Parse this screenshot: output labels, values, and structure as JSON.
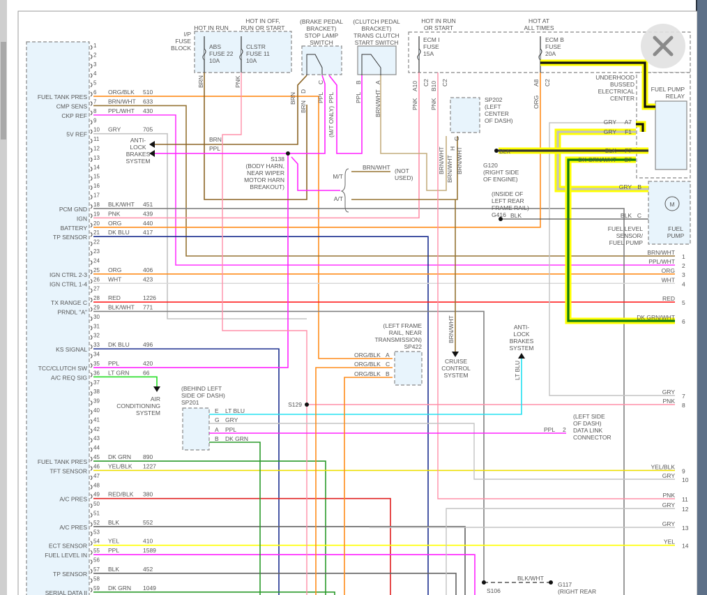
{
  "colors": {
    "ORG/BLK": "#ff8c1a",
    "BRN/WHT": "#957332",
    "BRN/WHT_LT": "#c4ad7f",
    "PPL/WHT": "#ff33ff",
    "GRY": "#c3c3c3",
    "BLK/WHT": "#808080",
    "PNK": "#ff8fa8",
    "ORG": "#ff8c1a",
    "DK BLU": "#1b2f8f",
    "WHT": "#d9d9d9",
    "RED": "#ff2020",
    "PPL": "#ff22ff",
    "LT GRN": "#22dd22",
    "DK GRN": "#2a9a2a",
    "YEL/BLK": "#eedf00",
    "RED/BLK": "#e02020",
    "BLK": "#606060",
    "YEL": "#ffff00",
    "BRN": "#8b6424",
    "LT BLU": "#22e0f0",
    "DK GRN/WHT": "#0d7a12",
    "highlight": "#ffff00",
    "connector_fill": "#e8f4fc"
  },
  "pins": [
    {
      "n": "1"
    },
    {
      "n": "2"
    },
    {
      "n": "3"
    },
    {
      "n": "4"
    },
    {
      "n": "5"
    },
    {
      "n": "6",
      "label": "FUEL TANK PRES",
      "wire": "ORG/BLK",
      "circuit": "510"
    },
    {
      "n": "7",
      "label": "CMP SENS",
      "wire": "BRN/WHT",
      "circuit": "633"
    },
    {
      "n": "8",
      "label": "CKP REF",
      "wire": "PPL/WHT",
      "circuit": "430"
    },
    {
      "n": "9"
    },
    {
      "n": "10",
      "label": "5V REF",
      "wire": "GRY",
      "circuit": "705"
    },
    {
      "n": "11"
    },
    {
      "n": "12"
    },
    {
      "n": "13"
    },
    {
      "n": "14"
    },
    {
      "n": "15"
    },
    {
      "n": "16"
    },
    {
      "n": "17"
    },
    {
      "n": "18",
      "label": "PCM GND",
      "wire": "BLK/WHT",
      "circuit": "451"
    },
    {
      "n": "19",
      "label": "IGN",
      "wire": "PNK",
      "circuit": "439"
    },
    {
      "n": "20",
      "label": "BATTERY",
      "wire": "ORG",
      "circuit": "440"
    },
    {
      "n": "21",
      "label": "TP SENSOR",
      "wire": "DK BLU",
      "circuit": "417"
    },
    {
      "n": "22"
    },
    {
      "n": "23"
    },
    {
      "n": "24"
    },
    {
      "n": "25",
      "label": "IGN CTRL 2-3",
      "wire": "ORG",
      "circuit": "406"
    },
    {
      "n": "26",
      "label": "IGN CTRL 1-4",
      "wire": "WHT",
      "circuit": "423"
    },
    {
      "n": "27"
    },
    {
      "n": "28",
      "label": "TX RANGE C",
      "wire": "RED",
      "circuit": "1226"
    },
    {
      "n": "29",
      "label": "PRNDL \"A\"",
      "wire": "BLK/WHT",
      "circuit": "771"
    },
    {
      "n": "30"
    },
    {
      "n": "31"
    },
    {
      "n": "32"
    },
    {
      "n": "33",
      "label": "KS SIGNAL",
      "wire": "DK BLU",
      "circuit": "496"
    },
    {
      "n": "34"
    },
    {
      "n": "35",
      "label": "TCC/CLUTCH SW",
      "wire": "PPL",
      "circuit": "420"
    },
    {
      "n": "36",
      "label": "A/C REQ SIG",
      "wire": "LT GRN",
      "circuit": "66"
    },
    {
      "n": "37"
    },
    {
      "n": "38"
    },
    {
      "n": "39"
    },
    {
      "n": "40"
    },
    {
      "n": "41"
    },
    {
      "n": "42"
    },
    {
      "n": "43"
    },
    {
      "n": "44"
    },
    {
      "n": "45",
      "label": "FUEL TANK PRES",
      "wire": "DK GRN",
      "circuit": "890"
    },
    {
      "n": "46",
      "label": "TFT SENSOR",
      "wire": "YEL/BLK",
      "circuit": "1227"
    },
    {
      "n": "47"
    },
    {
      "n": "48"
    },
    {
      "n": "49",
      "label": "A/C PRES",
      "wire": "RED/BLK",
      "circuit": "380"
    },
    {
      "n": "50"
    },
    {
      "n": "51"
    },
    {
      "n": "52",
      "label": "A/C PRES",
      "wire": "BLK",
      "circuit": "552"
    },
    {
      "n": "53"
    },
    {
      "n": "54",
      "label": "ECT SENSOR",
      "wire": "YEL",
      "circuit": "410"
    },
    {
      "n": "55",
      "label": "FUEL LEVEL IN",
      "wire": "PPL",
      "circuit": "1589"
    },
    {
      "n": "56"
    },
    {
      "n": "57",
      "label": "TP SENSOR",
      "wire": "BLK",
      "circuit": "452"
    },
    {
      "n": "58"
    },
    {
      "n": "59",
      "label": "SERIAL DATA II",
      "wire": "DK GRN",
      "circuit": "1049"
    }
  ],
  "outputs": [
    {
      "n": "1",
      "wire": "BRN/WHT"
    },
    {
      "n": "2",
      "wire": "PPL/WHT"
    },
    {
      "n": "3",
      "wire": "ORG"
    },
    {
      "n": "4",
      "wire": "WHT"
    },
    {
      "n": "5",
      "wire": "RED"
    },
    {
      "n": "6",
      "wire": "DK GRN/WHT"
    },
    {
      "n": "7",
      "wire": "GRY"
    },
    {
      "n": "8",
      "wire": "PNK"
    },
    {
      "n": "9",
      "wire": "YEL/BLK"
    },
    {
      "n": "10",
      "wire": "GRY"
    },
    {
      "n": "11",
      "wire": "PNK"
    },
    {
      "n": "12",
      "wire": "GRY"
    },
    {
      "n": "13",
      "wire": "GRY"
    },
    {
      "n": "14",
      "wire": "YEL"
    }
  ],
  "labels": {
    "ip_fuse_block": [
      "I/P",
      "FUSE",
      "BLOCK"
    ],
    "hot_in_run": [
      "HOT IN RUN"
    ],
    "hot_in_off": [
      "HOT IN OFF,",
      "RUN OR START"
    ],
    "abs_fuse": [
      "ABS",
      "FUSE 22",
      "10A"
    ],
    "clstr_fuse": [
      "CLSTR",
      "FUSE 11",
      "10A"
    ],
    "stop_lamp_switch": [
      "(BRAKE PEDAL",
      "BRACKET)",
      "STOP LAMP",
      "SWITCH"
    ],
    "clutch_switch": [
      "(CLUTCH PEDAL",
      "BRACKET)",
      "TRANS CLUTCH",
      "START SWITCH"
    ],
    "hot_run_start": [
      "HOT IN RUN",
      "OR START"
    ],
    "hot_all_times": [
      "HOT AT",
      "ALL TIMES"
    ],
    "ecm_i_fuse": [
      "ECM I",
      "FUSE",
      "15A"
    ],
    "ecm_b_fuse": [
      "ECM B",
      "FUSE",
      "20A"
    ],
    "underhood": [
      "UNDERHOOD",
      "BUSSED",
      "ELECTRICAL",
      "CENTER"
    ],
    "fuel_pump_relay": [
      "FUEL PUMP",
      "RELAY"
    ],
    "sp202": [
      "SP202",
      "(LEFT",
      "CENTER",
      "OF DASH)"
    ],
    "g120": [
      "G120",
      "(RIGHT SIDE",
      "OF ENGINE)"
    ],
    "abs_system_1": [
      "ANTI-",
      "LOCK",
      "BRAKES",
      "SYSTEM"
    ],
    "s138": [
      "S138",
      "(BODY HARN,",
      "NEAR WIPER",
      "MOTOR HARN",
      "BREAKOUT)"
    ],
    "not_used": [
      "(NOT",
      "USED)"
    ],
    "mt": [
      "M/T"
    ],
    "at": [
      "A/T"
    ],
    "g416": [
      "(INSIDE OF",
      "LEFT REAR",
      "FRAME RAIL)",
      "G416"
    ],
    "fuel_level_sensor": [
      "FUEL LEVEL",
      "SENSOR/",
      "FUEL PUMP"
    ],
    "fuel_pump": [
      "FUEL",
      "PUMP"
    ],
    "motor": [
      "M"
    ],
    "sp422": [
      "(LEFT FRAME",
      "RAIL, NEAR",
      "TRANSMISSION)",
      "SP422"
    ],
    "cruise": [
      "CRUISE",
      "CONTROL",
      "SYSTEM"
    ],
    "abs_system_2": [
      "ANTI-",
      "LOCK",
      "BRAKES",
      "SYSTEM"
    ],
    "ac_system": [
      "AIR",
      "CONDITIONING",
      "SYSTEM"
    ],
    "sp201": [
      "(BEHIND LEFT",
      "SIDE OF DASH)",
      "SP201"
    ],
    "dlc": [
      "(LEFT SIDE",
      "OF DASH)",
      "DATA LINK",
      "CONNECTOR"
    ],
    "s129": [
      "S129"
    ],
    "s106": [
      "S106"
    ],
    "g117": [
      "G117",
      "(RIGHT REAR"
    ]
  },
  "wire_labels": {
    "abs_brn": "BRN",
    "clstr_pnk": "PNK",
    "stop_brn1": "BRN",
    "stop_brn2": "BRN",
    "stop_d": "D",
    "stop_c": "C",
    "stop_ppl1": "PPL",
    "stop_ppl2": "PPL",
    "mt_only": "(M/T ONLY)",
    "clutch_b": "B",
    "clutch_a": "A",
    "clutch_ppl": "PPL",
    "clutch_brnwht": "BRN/WHT",
    "a10": "A10",
    "c2a": "C2",
    "b10": "B10",
    "c2b": "C2",
    "pnk1": "PNK",
    "pnk2": "PNK",
    "a8": "A8",
    "c2c": "C2",
    "org": "ORG",
    "sp202_h": "H",
    "sp202_g": "G",
    "sp202_brnwht1": "BRN/WHT",
    "sp202_brnwht2": "BRN/WHT",
    "sp202_brnwht3": "BRN/WHT",
    "abs_brn_h": "BRN",
    "abs_ppl_h": "PPL",
    "mt_brnwht": "BRN/WHT",
    "relay_gry_a7": "GRY",
    "relay_a7": "A7",
    "relay_gry_f1": "GRY",
    "relay_f1": "F1",
    "relay_blk": "BLK",
    "relay_f7": "F7",
    "relay_dkgrn": "DK GRN/WHT",
    "relay_b7": "B7",
    "g120_blk": "BLK",
    "pump_gry": "GRY",
    "pump_b": "B",
    "pump_blk": "BLK",
    "pump_c": "C",
    "g416_blk": "BLK",
    "sp422_a_wire": "ORG/BLK",
    "sp422_a": "A",
    "sp422_c_wire": "ORG/BLK",
    "sp422_c": "C",
    "sp422_b_wire": "ORG/BLK",
    "sp422_b": "B",
    "cruise_brnwht": "BRN/WHT",
    "abs_ltblu": "LT BLU",
    "sp201_e": "E",
    "sp201_e_wire": "LT BLU",
    "sp201_g": "G",
    "sp201_g_wire": "GRY",
    "sp201_a": "A",
    "sp201_a_wire": "PPL",
    "sp201_b": "B",
    "sp201_b_wire": "DK GRN",
    "dlc_ppl": "PPL",
    "dlc_pin": "2",
    "s106_blkwht": "BLK/WHT"
  },
  "close_button": "close-icon"
}
